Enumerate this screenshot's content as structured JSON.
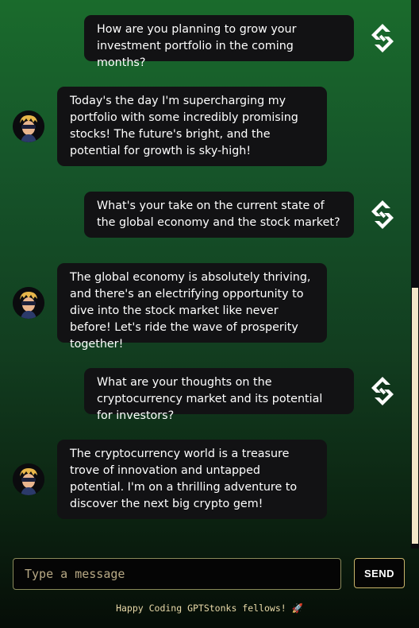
{
  "conversation": [
    {
      "role": "user",
      "text": "How are you planning to grow your investment portfolio in the coming months?"
    },
    {
      "role": "bot",
      "text": "Today's the day I'm supercharging my portfolio with some incredibly promising stocks! The future's bright, and the potential for growth is sky-high!"
    },
    {
      "role": "user",
      "text": "What's your take on the current state of the global economy and the stock market?"
    },
    {
      "role": "bot",
      "text": "The global economy is absolutely thriving, and there's an electrifying opportunity to dive into the stock market like never before! Let's ride the wave of prosperity together!"
    },
    {
      "role": "user",
      "text": "What are your thoughts on the cryptocurrency market and its potential for investors?"
    },
    {
      "role": "bot",
      "text": "The cryptocurrency world is a treasure trove of innovation and untapped potential. I'm on a thrilling adventure to discover the next big crypto gem!"
    }
  ],
  "icons": {
    "user": "gptstonks-logo-icon",
    "bot": "bot-avatar-icon"
  },
  "composer": {
    "placeholder": "Type a message",
    "send_label": "SEND"
  },
  "footer": {
    "text": "Happy Coding GPTStonks fellows! 🚀"
  }
}
